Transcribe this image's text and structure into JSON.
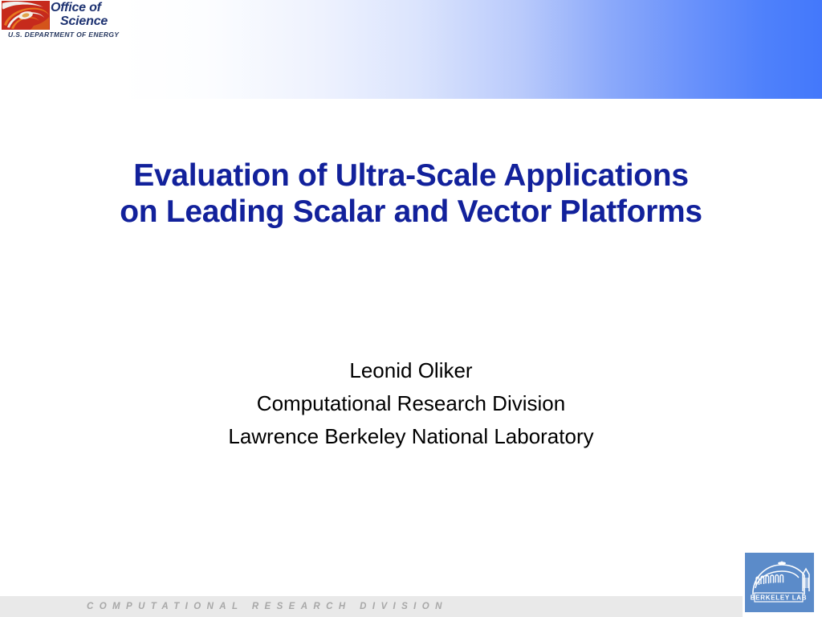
{
  "slide": {
    "header": {
      "gradient_start_color": "#ffffff",
      "gradient_end_color": "#4378fb",
      "doe_logo": {
        "icon": "doe-swirl-icon",
        "wordmark_line1": "Office of",
        "wordmark_line2": "Science",
        "department": "U.S. DEPARTMENT OF ENERGY",
        "wordmark_color": "#1d3271"
      }
    },
    "title": {
      "color": "#12219b",
      "lines": [
        "Evaluation of Ultra-Scale Applications",
        "on Leading Scalar and Vector Platforms"
      ]
    },
    "author": {
      "color": "#000000",
      "lines": [
        "Leonid Oliker",
        "Computational Research Division",
        "Lawrence Berkeley National Laboratory"
      ]
    },
    "footer": {
      "bar_color": "#e9e9e9",
      "text": "COMPUTATIONAL RESEARCH DIVISION",
      "text_color": "#a8a8a8",
      "berkeley_logo": {
        "icon": "berkeley-lab-dome-icon",
        "label": "BERKELEY LAB",
        "background_color": "#5b8bc9"
      }
    }
  }
}
